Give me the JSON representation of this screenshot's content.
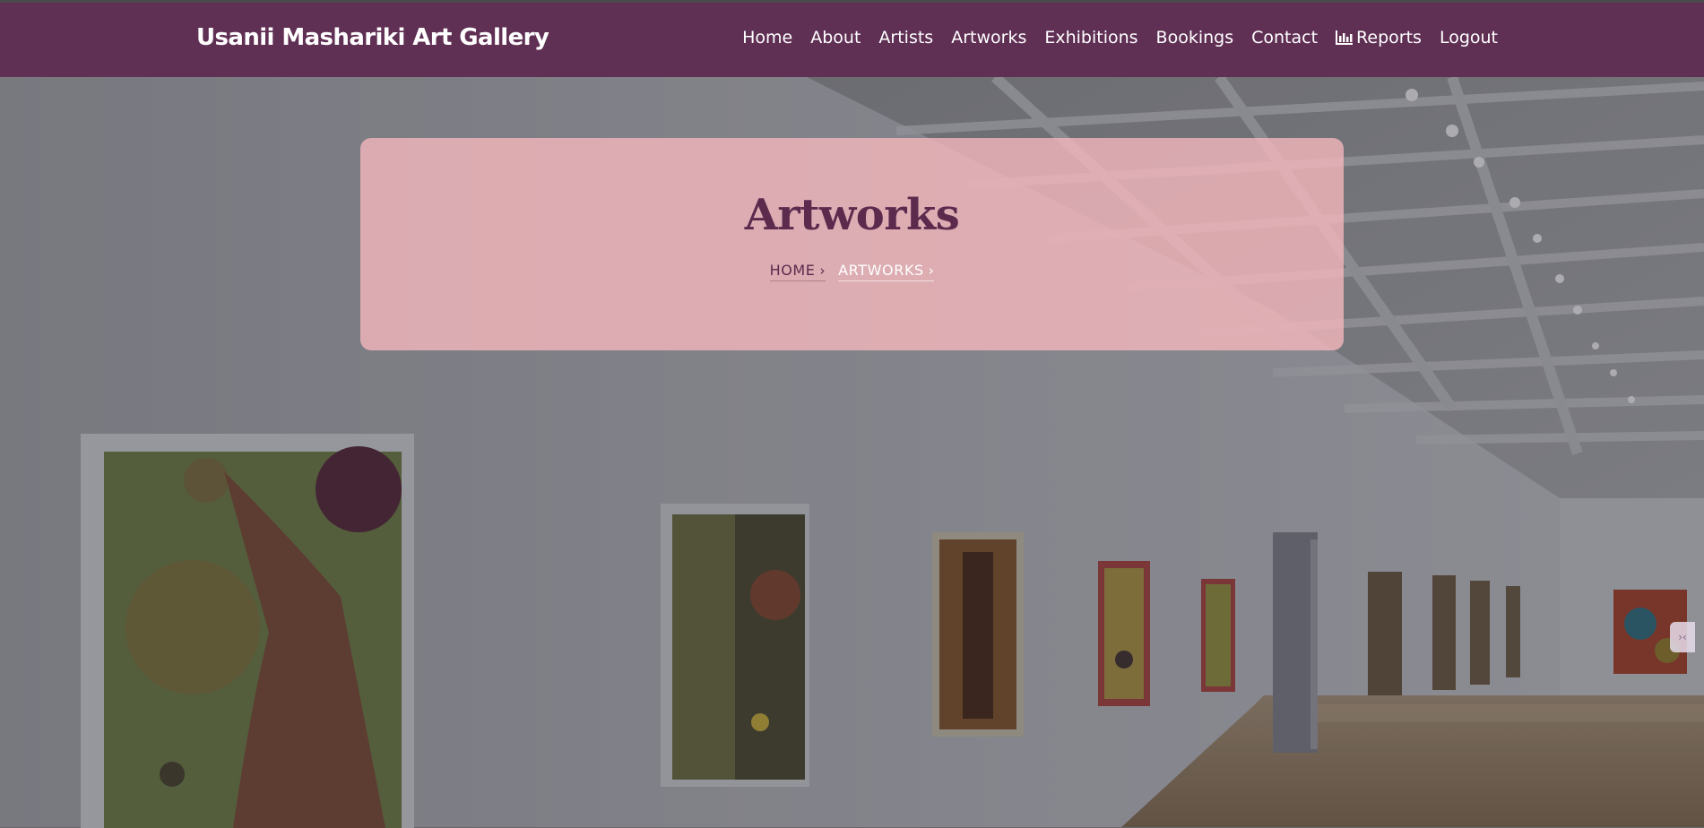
{
  "brand": {
    "name": "Usanii Mashariki Art Gallery"
  },
  "nav": {
    "items": [
      {
        "label": "Home"
      },
      {
        "label": "About"
      },
      {
        "label": "Artists"
      },
      {
        "label": "Artworks"
      },
      {
        "label": "Exhibitions"
      },
      {
        "label": "Bookings"
      },
      {
        "label": "Contact"
      },
      {
        "label": "Reports",
        "icon": "bar-chart-icon"
      },
      {
        "label": "Logout"
      }
    ]
  },
  "hero": {
    "title": "Artworks",
    "breadcrumb": [
      {
        "label": "HOME"
      },
      {
        "label": "ARTWORKS"
      }
    ],
    "background": "gallery-interior-photo"
  },
  "colors": {
    "navbar": "#602f54",
    "title": "#5c2a4d",
    "card": "#f6b8be",
    "nav_text": "#ffffff"
  }
}
